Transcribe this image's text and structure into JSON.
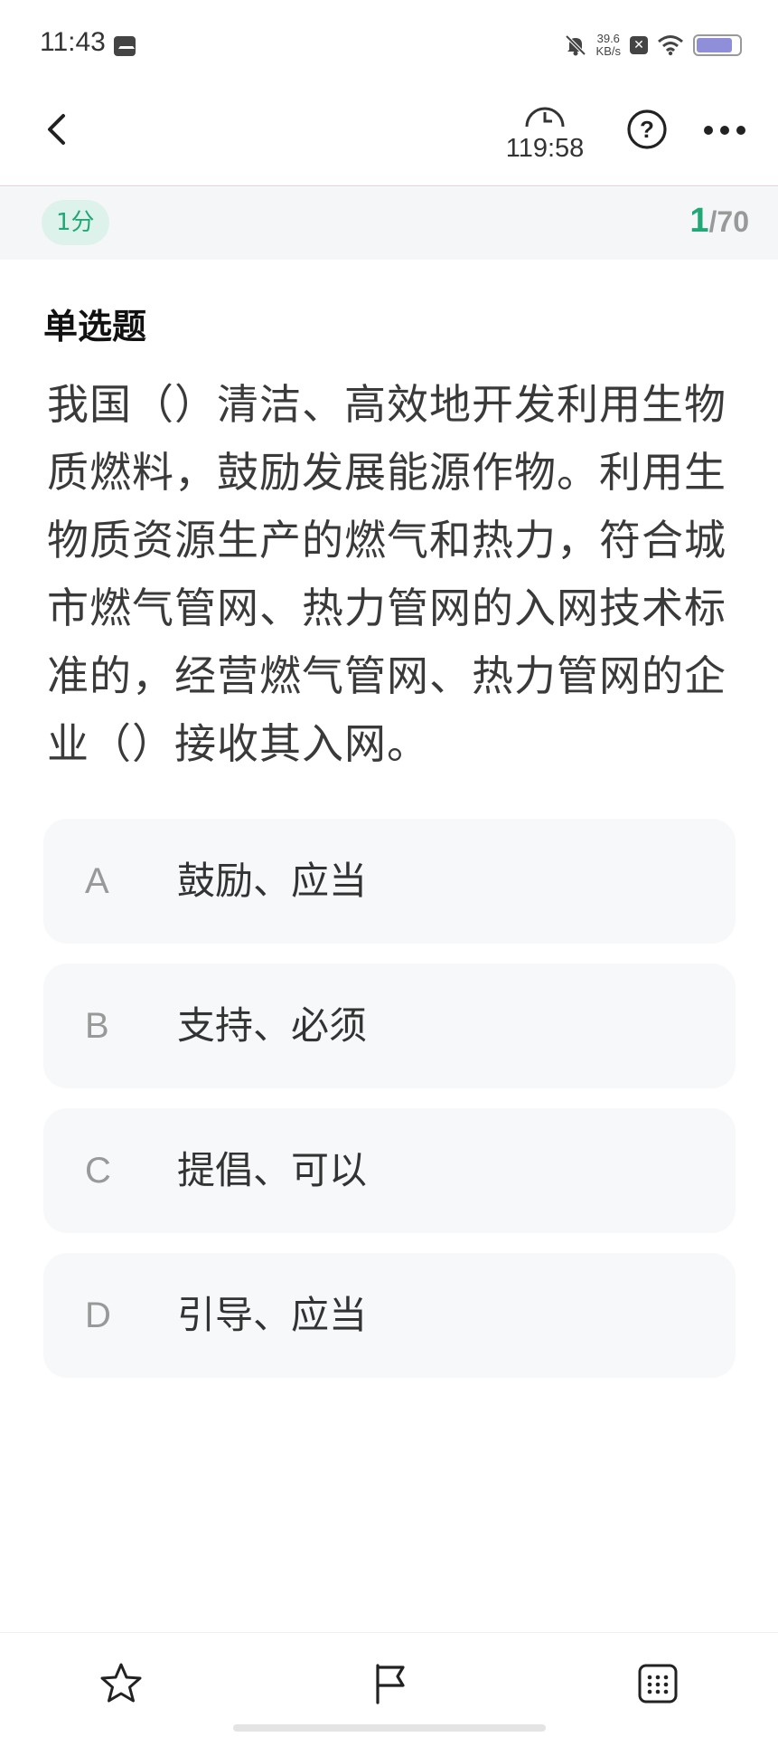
{
  "status_bar": {
    "time": "11:43",
    "net_speed_value": "39.6",
    "net_speed_unit": "KB/s",
    "battery_level": 0.85
  },
  "header": {
    "timer": "119:58",
    "icons": [
      "back-arrow-icon",
      "clock-icon",
      "help-icon",
      "more-icon"
    ]
  },
  "score_bar": {
    "score": "1分",
    "current": "1",
    "total": "/70"
  },
  "question": {
    "type": "单选题",
    "text": "我国（）清洁、高效地开发利用生物质燃料，鼓励发展能源作物。利用生物质资源生产的燃气和热力，符合城市燃气管网、热力管网的入网技术标准的，经营燃气管网、热力管网的企业（）接收其入网。"
  },
  "options": [
    {
      "letter": "A",
      "text": "鼓励、应当"
    },
    {
      "letter": "B",
      "text": "支持、必须"
    },
    {
      "letter": "C",
      "text": "提倡、可以"
    },
    {
      "letter": "D",
      "text": "引导、应当"
    }
  ],
  "bottom_bar": {
    "icons": [
      "star-icon",
      "flag-icon",
      "grid-icon"
    ]
  },
  "colors": {
    "accent": "#22a877",
    "badge_bg": "#ddf2ea",
    "option_bg": "#f7f8fa"
  }
}
